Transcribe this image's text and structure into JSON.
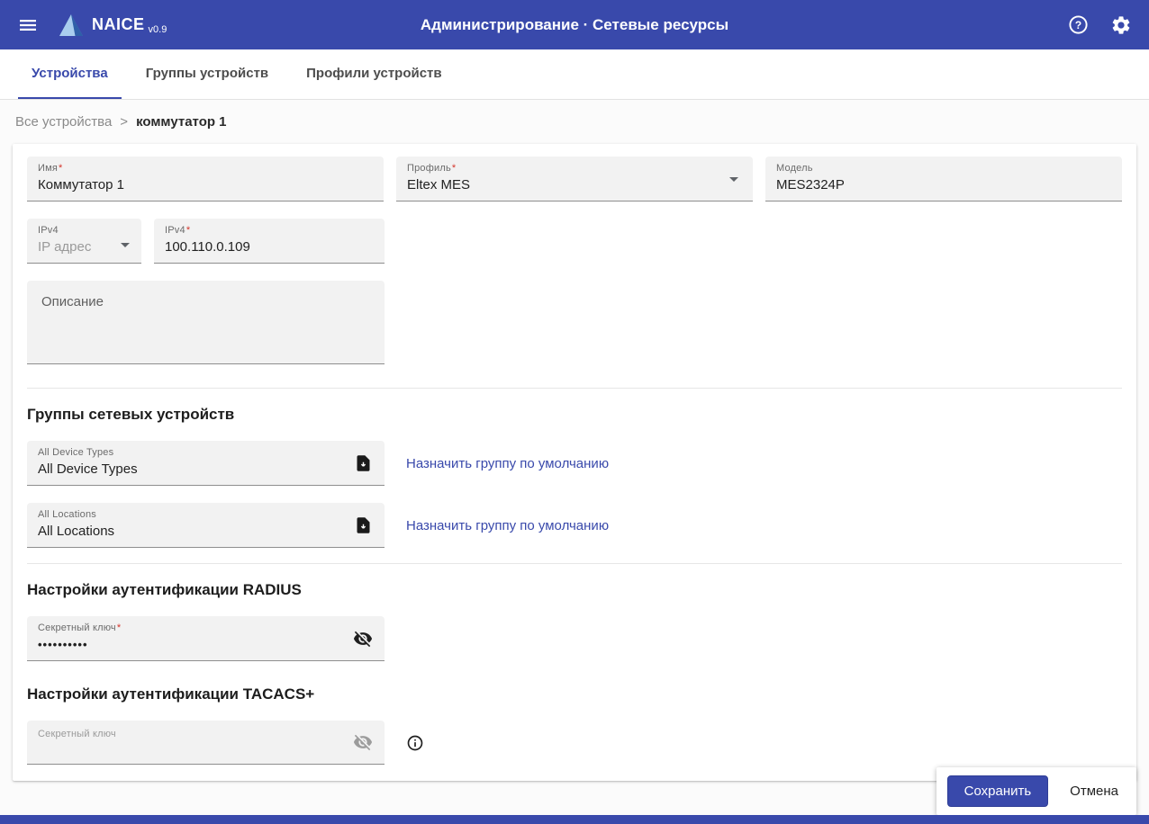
{
  "colors": {
    "primary": "#3949ab",
    "link": "#3949ab",
    "required": "#d4342a",
    "field_background": "#f2f2f2"
  },
  "header": {
    "app_name": "NAICE",
    "app_version": "v0.9",
    "title": "Администрирование · Сетевые ресурсы"
  },
  "tabs": [
    {
      "label": "Устройства",
      "active": true
    },
    {
      "label": "Группы устройств",
      "active": false
    },
    {
      "label": "Профили устройств",
      "active": false
    }
  ],
  "breadcrumb": {
    "parent": "Все устройства",
    "separator": ">",
    "current": "коммутатор 1"
  },
  "required_mark": "*",
  "form": {
    "name": {
      "label": "Имя",
      "value": "Коммутатор 1",
      "required": true
    },
    "profile": {
      "label": "Профиль",
      "value": "Eltex MES",
      "required": true
    },
    "model": {
      "label": "Модель",
      "value": "MES2324P",
      "required": false
    },
    "ip_version": {
      "label": "IPv4",
      "placeholder": "IP адрес"
    },
    "ip_address": {
      "label": "IPv4",
      "value": "100.110.0.109",
      "required": true
    },
    "description": {
      "placeholder": "Описание"
    }
  },
  "groups": {
    "title": "Группы сетевых устройств",
    "items": [
      {
        "label": "All Device Types",
        "value": "All Device Types",
        "action": "Назначить группу по умолчанию"
      },
      {
        "label": "All Locations",
        "value": "All Locations",
        "action": "Назначить группу по умолчанию"
      }
    ]
  },
  "radius": {
    "title": "Настройки аутентификации RADIUS",
    "secret": {
      "label": "Секретный ключ",
      "value": "••••••••••",
      "required": true
    }
  },
  "tacacs": {
    "title": "Настройки аутентификации TACACS+",
    "secret": {
      "label": "Секретный ключ",
      "value": ""
    }
  },
  "actions": {
    "save": "Сохранить",
    "cancel": "Отмена"
  },
  "icons": {
    "menu_icon": "☰",
    "help_icon": "?",
    "settings_gear_icon": "⚙",
    "chevron_down_icon": "▾",
    "assign_file_icon": "🗎",
    "eye_off_icon": "visibility-off",
    "info_icon": "ⓘ"
  }
}
